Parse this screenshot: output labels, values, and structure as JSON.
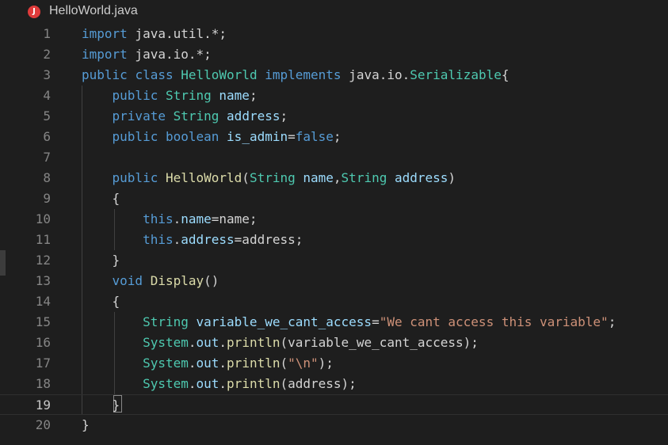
{
  "tab": {
    "icon": "java-file-icon",
    "icon_letter": "J",
    "title": "HelloWorld.java"
  },
  "colors": {
    "background": "#1e1e1e",
    "keyword": "#569cd6",
    "type": "#4ec9b0",
    "variable": "#9cdcfe",
    "function": "#dcdcaa",
    "string": "#ce9178",
    "plain": "#d4d4d4",
    "line_number": "#858585"
  },
  "editor": {
    "current_line": 19,
    "lines": [
      {
        "n": "1",
        "tokens": [
          [
            "kw",
            "import"
          ],
          [
            "pl",
            " java.util.*;"
          ]
        ]
      },
      {
        "n": "2",
        "tokens": [
          [
            "kw",
            "import"
          ],
          [
            "pl",
            " java.io.*;"
          ]
        ]
      },
      {
        "n": "3",
        "tokens": [
          [
            "kw",
            "public"
          ],
          [
            "pl",
            " "
          ],
          [
            "kw",
            "class"
          ],
          [
            "pl",
            " "
          ],
          [
            "ty",
            "HelloWorld"
          ],
          [
            "pl",
            " "
          ],
          [
            "kw",
            "implements"
          ],
          [
            "pl",
            " java.io."
          ],
          [
            "ty",
            "Serializable"
          ],
          [
            "pl",
            "{"
          ]
        ]
      },
      {
        "n": "4",
        "tokens": [
          [
            "pl",
            "    "
          ],
          [
            "kw",
            "public"
          ],
          [
            "pl",
            " "
          ],
          [
            "ty",
            "String"
          ],
          [
            "pl",
            " "
          ],
          [
            "va",
            "name"
          ],
          [
            "pl",
            ";"
          ]
        ]
      },
      {
        "n": "5",
        "tokens": [
          [
            "pl",
            "    "
          ],
          [
            "kw",
            "private"
          ],
          [
            "pl",
            " "
          ],
          [
            "ty",
            "String"
          ],
          [
            "pl",
            " "
          ],
          [
            "va",
            "address"
          ],
          [
            "pl",
            ";"
          ]
        ]
      },
      {
        "n": "6",
        "tokens": [
          [
            "pl",
            "    "
          ],
          [
            "kw",
            "public"
          ],
          [
            "pl",
            " "
          ],
          [
            "kw",
            "boolean"
          ],
          [
            "pl",
            " "
          ],
          [
            "va",
            "is_admin"
          ],
          [
            "pl",
            "="
          ],
          [
            "kw",
            "false"
          ],
          [
            "pl",
            ";"
          ]
        ]
      },
      {
        "n": "7",
        "tokens": []
      },
      {
        "n": "8",
        "tokens": [
          [
            "pl",
            "    "
          ],
          [
            "kw",
            "public"
          ],
          [
            "pl",
            " "
          ],
          [
            "fn",
            "HelloWorld"
          ],
          [
            "pl",
            "("
          ],
          [
            "ty",
            "String"
          ],
          [
            "pl",
            " "
          ],
          [
            "va",
            "name"
          ],
          [
            "pl",
            ","
          ],
          [
            "ty",
            "String"
          ],
          [
            "pl",
            " "
          ],
          [
            "va",
            "address"
          ],
          [
            "pl",
            ")"
          ]
        ]
      },
      {
        "n": "9",
        "tokens": [
          [
            "pl",
            "    {"
          ]
        ]
      },
      {
        "n": "10",
        "tokens": [
          [
            "pl",
            "        "
          ],
          [
            "kw",
            "this"
          ],
          [
            "pl",
            "."
          ],
          [
            "va",
            "name"
          ],
          [
            "pl",
            "=name;"
          ]
        ]
      },
      {
        "n": "11",
        "tokens": [
          [
            "pl",
            "        "
          ],
          [
            "kw",
            "this"
          ],
          [
            "pl",
            "."
          ],
          [
            "va",
            "address"
          ],
          [
            "pl",
            "=address;"
          ]
        ]
      },
      {
        "n": "12",
        "tokens": [
          [
            "pl",
            "    }"
          ]
        ]
      },
      {
        "n": "13",
        "tokens": [
          [
            "pl",
            "    "
          ],
          [
            "kw",
            "void"
          ],
          [
            "pl",
            " "
          ],
          [
            "fn",
            "Display"
          ],
          [
            "pl",
            "()"
          ]
        ]
      },
      {
        "n": "14",
        "tokens": [
          [
            "pl",
            "    {"
          ]
        ]
      },
      {
        "n": "15",
        "tokens": [
          [
            "pl",
            "        "
          ],
          [
            "ty",
            "String"
          ],
          [
            "pl",
            " "
          ],
          [
            "va",
            "variable_we_cant_access"
          ],
          [
            "pl",
            "="
          ],
          [
            "st",
            "\"We cant access this variable\""
          ],
          [
            "pl",
            ";"
          ]
        ]
      },
      {
        "n": "16",
        "tokens": [
          [
            "pl",
            "        "
          ],
          [
            "ty",
            "System"
          ],
          [
            "pl",
            "."
          ],
          [
            "va",
            "out"
          ],
          [
            "pl",
            "."
          ],
          [
            "fn",
            "println"
          ],
          [
            "pl",
            "(variable_we_cant_access);"
          ]
        ]
      },
      {
        "n": "17",
        "tokens": [
          [
            "pl",
            "        "
          ],
          [
            "ty",
            "System"
          ],
          [
            "pl",
            "."
          ],
          [
            "va",
            "out"
          ],
          [
            "pl",
            "."
          ],
          [
            "fn",
            "println"
          ],
          [
            "pl",
            "("
          ],
          [
            "st",
            "\"\\n\""
          ],
          [
            "pl",
            ");"
          ]
        ]
      },
      {
        "n": "18",
        "tokens": [
          [
            "pl",
            "        "
          ],
          [
            "ty",
            "System"
          ],
          [
            "pl",
            "."
          ],
          [
            "va",
            "out"
          ],
          [
            "pl",
            "."
          ],
          [
            "fn",
            "println"
          ],
          [
            "pl",
            "(address);"
          ]
        ]
      },
      {
        "n": "19",
        "tokens": [
          [
            "pl",
            "    }"
          ]
        ]
      },
      {
        "n": "20",
        "tokens": [
          [
            "pl",
            "}"
          ]
        ]
      }
    ]
  }
}
